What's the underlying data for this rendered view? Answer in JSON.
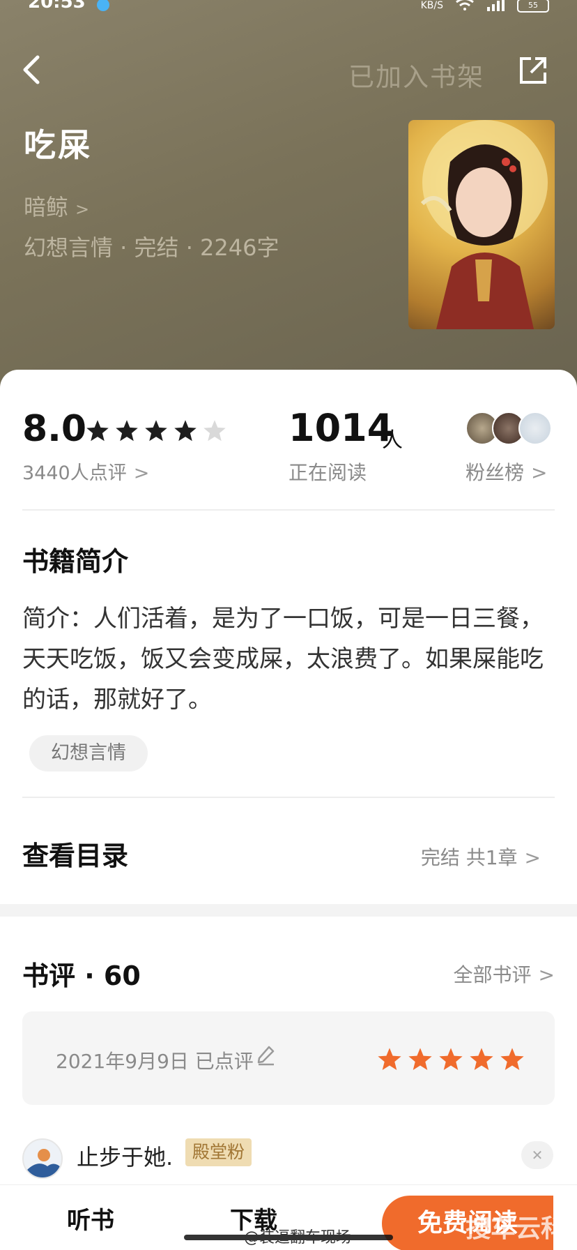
{
  "status_bar": {
    "time": "20:53",
    "network_speed": "KB/S",
    "battery": "55"
  },
  "header": {
    "shelf_label": "已加入书架",
    "title": "吃屎",
    "author": "暗鲸",
    "meta": "幻想言情 · 完结 · 2246字"
  },
  "stats": {
    "score": "8.0",
    "rating_stars": 4,
    "rating_max": 5,
    "review_count": "3440人点评",
    "readers_num": "1014",
    "readers_unit": "人",
    "readers_label": "正在阅读",
    "fans_label": "粉丝榜"
  },
  "intro": {
    "title": "书籍简介",
    "text": "简介：人们活着，是为了一口饭，可是一日三餐，天天吃饭，饭又会变成屎，太浪费了。如果屎能吃的话，那就好了。",
    "tag": "幻想言情"
  },
  "toc": {
    "title": "查看目录",
    "status": "完结 共1章"
  },
  "reviews": {
    "title": "书评 · 60",
    "all_label": "全部书评",
    "my_review_date": "2021年9月9日 已点评",
    "my_stars": 5,
    "first_reviewer": "止步于她.",
    "first_badge": "殿堂粉"
  },
  "bottom_bar": {
    "listen": "听书",
    "download": "下载",
    "read": "免费阅读"
  },
  "watermarks": {
    "weibo": "@装逼翻车现场",
    "corner": "搜车云科"
  },
  "colors": {
    "header_bg": "#7a7259",
    "accent": "#f06b2c",
    "star_filled": "#1e1e1e",
    "star_empty": "#d9d9d9",
    "badge_bg": "#efdcb2"
  }
}
